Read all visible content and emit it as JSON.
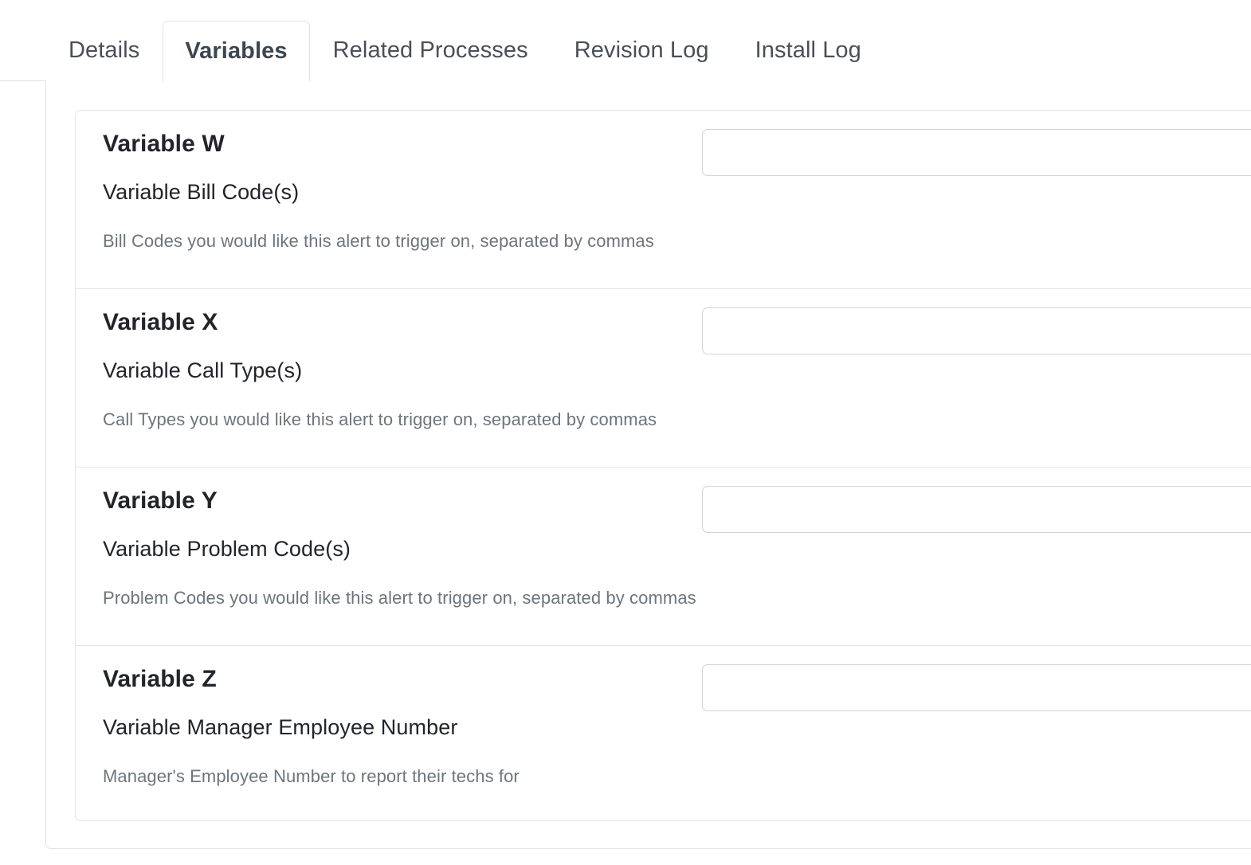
{
  "tabs": [
    {
      "label": "Details",
      "active": false
    },
    {
      "label": "Variables",
      "active": true
    },
    {
      "label": "Related Processes",
      "active": false
    },
    {
      "label": "Revision Log",
      "active": false
    },
    {
      "label": "Install Log",
      "active": false
    }
  ],
  "variables": [
    {
      "title": "Variable W",
      "label": "Variable Bill Code(s)",
      "help": "Bill Codes you would like this alert to trigger on, separated by commas",
      "value": "",
      "placeholder": ""
    },
    {
      "title": "Variable X",
      "label": "Variable Call Type(s)",
      "help": "Call Types you would like this alert to trigger on, separated by commas",
      "value": "",
      "placeholder": ""
    },
    {
      "title": "Variable Y",
      "label": "Variable Problem Code(s)",
      "help": "Problem Codes you would like this alert to trigger on, separated by commas",
      "value": "",
      "placeholder": ""
    },
    {
      "title": "Variable Z",
      "label": "Variable Manager Employee Number",
      "help": "Manager's Employee Number to report their techs for",
      "value": "",
      "placeholder": ""
    }
  ],
  "colors": {
    "border": "#dee2e6",
    "panel_border": "#e3e6e8",
    "input_border": "#ced4da",
    "text": "#212529",
    "muted_text": "#6c757d",
    "tab_text": "#495057",
    "tab_active_text": "#3c4651",
    "background": "#ffffff"
  }
}
